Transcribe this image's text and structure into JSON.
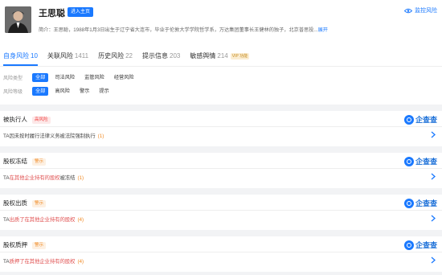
{
  "header": {
    "name": "王思聪",
    "enter_label": "进入主页",
    "monitor_label": "监控风险",
    "intro_prefix": "简介：王思聪，1988年1月3日出生于辽宁省大连市，毕业于伦敦大学学院哲学系，万达集团董事长王健林的独子，北京普思投...",
    "intro_expand": "展开"
  },
  "tabs": [
    {
      "label": "自身风险",
      "count": "10",
      "active": true
    },
    {
      "label": "关联风险",
      "count": "1411"
    },
    {
      "label": "历史风险",
      "count": "22"
    },
    {
      "label": "提示信息",
      "count": "203"
    },
    {
      "label": "敏感舆情",
      "count": "214",
      "badge": "VIP 功能"
    }
  ],
  "filters": {
    "type": {
      "label": "风险类型",
      "options": [
        "全部",
        "司法风险",
        "监管风险",
        "经营风险"
      ]
    },
    "level": {
      "label": "风险等级",
      "options": [
        "全部",
        "高风险",
        "警示",
        "提示"
      ]
    }
  },
  "brand": "企查查",
  "sections": [
    {
      "title": "被执行人",
      "tag": "高风险",
      "tag_type": "high",
      "pre": "TA因未按时履行法律义务被法院强制执行",
      "red": "",
      "post": "",
      "count": "(1)"
    },
    {
      "title": "股权冻结",
      "tag": "警示",
      "tag_type": "warn",
      "pre": "TA",
      "red": "在其他企业持有的股权",
      "post": "被冻结",
      "count": "(1)"
    },
    {
      "title": "股权出质",
      "tag": "警示",
      "tag_type": "warn",
      "pre": "TA",
      "red": "出质了在其他企业持有的股权",
      "post": "",
      "count": "(4)"
    },
    {
      "title": "股权质押",
      "tag": "警示",
      "tag_type": "warn",
      "pre": "TA",
      "red": "质押了在其他企业持有的股权",
      "post": "",
      "count": "(4)"
    }
  ],
  "colors": {
    "accent": "#1a79ff",
    "high": "#f04040",
    "warn": "#f08a24"
  }
}
